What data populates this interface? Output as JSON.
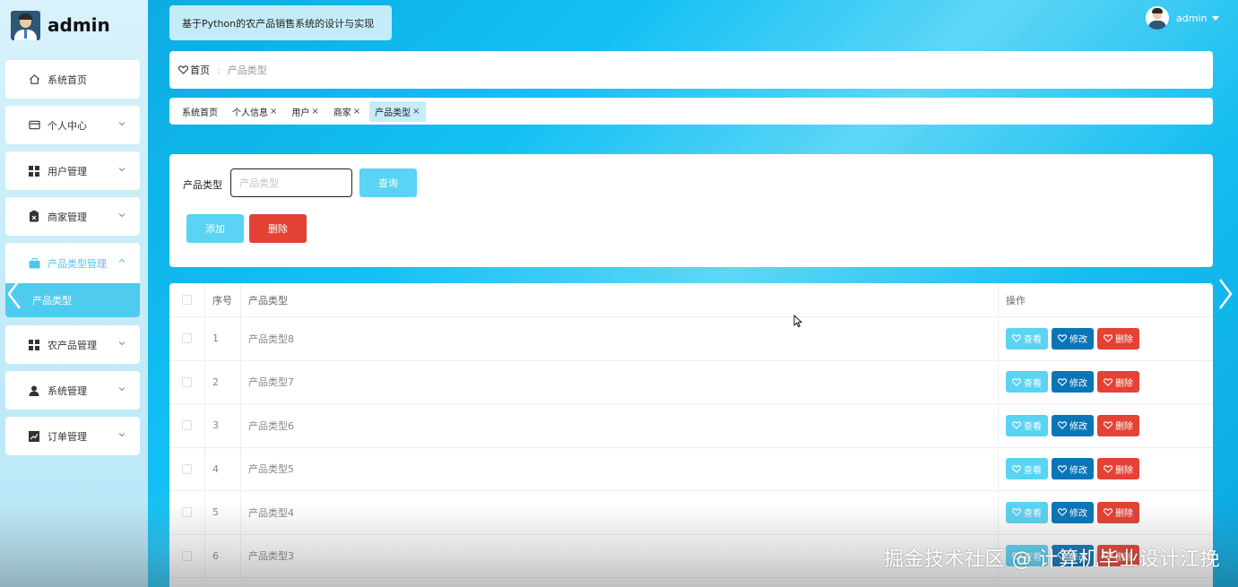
{
  "sidebar": {
    "brand_name": "admin",
    "items": [
      {
        "label": "系统首页"
      },
      {
        "label": "个人中心"
      },
      {
        "label": "用户管理"
      },
      {
        "label": "商家管理"
      },
      {
        "label": "产品类型管理"
      },
      {
        "label": "农产品管理"
      },
      {
        "label": "系统管理"
      },
      {
        "label": "订单管理"
      }
    ],
    "active_sub": "产品类型"
  },
  "header": {
    "system_title": "基于Python的农产品销售系统的设计与实现",
    "username": "admin"
  },
  "breadcrumb": {
    "home": "首页",
    "separator": ":",
    "current": "产品类型"
  },
  "tabs": [
    {
      "label": "系统首页",
      "closable": false
    },
    {
      "label": "个人信息",
      "closable": true
    },
    {
      "label": "用户",
      "closable": true
    },
    {
      "label": "商家",
      "closable": true
    },
    {
      "label": "产品类型",
      "closable": true,
      "active": true
    }
  ],
  "search": {
    "label": "产品类型",
    "placeholder": "产品类型",
    "query_button": "查询",
    "add_button": "添加",
    "delete_button": "删除"
  },
  "table": {
    "headers": {
      "index": "序号",
      "name": "产品类型",
      "ops": "操作"
    },
    "rows": [
      {
        "index": "1",
        "name": "产品类型8"
      },
      {
        "index": "2",
        "name": "产品类型7"
      },
      {
        "index": "3",
        "name": "产品类型6"
      },
      {
        "index": "4",
        "name": "产品类型5"
      },
      {
        "index": "5",
        "name": "产品类型4"
      },
      {
        "index": "6",
        "name": "产品类型3"
      }
    ],
    "actions": {
      "view": "查看",
      "edit": "修改",
      "delete": "删除"
    }
  },
  "watermark": "掘金技术社区 @ 计算机毕业设计江挽",
  "colors": {
    "accent": "#5ad3f4",
    "edit": "#0a76b8",
    "danger": "#e34234",
    "background": "#12c0f4"
  }
}
